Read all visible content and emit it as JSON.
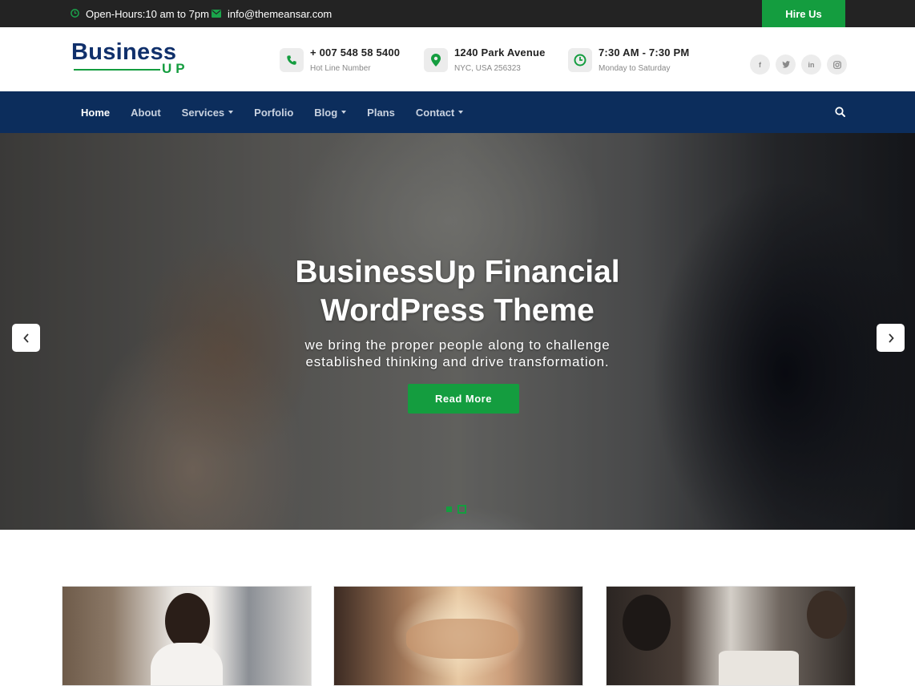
{
  "topbar": {
    "hours": "Open-Hours:10 am to 7pm",
    "email": "info@themeansar.com",
    "hire_label": "Hire Us"
  },
  "logo": {
    "main": "Business",
    "sub": "UP"
  },
  "contacts": [
    {
      "title": "+ 007 548 58 5400",
      "sub": "Hot Line Number",
      "icon": "phone-icon"
    },
    {
      "title": "1240 Park Avenue",
      "sub": "NYC, USA 256323",
      "icon": "map-pin-icon"
    },
    {
      "title": "7:30 AM - 7:30 PM",
      "sub": "Monday to Saturday",
      "icon": "clock-icon"
    }
  ],
  "socials": [
    "f",
    "t",
    "in",
    "ig"
  ],
  "nav": {
    "items": [
      {
        "label": "Home",
        "dropdown": false
      },
      {
        "label": "About",
        "dropdown": false
      },
      {
        "label": "Services",
        "dropdown": true
      },
      {
        "label": "Porfolio",
        "dropdown": false
      },
      {
        "label": "Blog",
        "dropdown": true
      },
      {
        "label": "Plans",
        "dropdown": false
      },
      {
        "label": "Contact",
        "dropdown": true
      }
    ]
  },
  "hero": {
    "title_line1": "BusinessUp Financial",
    "title_line2": "WordPress Theme",
    "sub_line1": "we bring the proper people along to challenge",
    "sub_line2": "established thinking and drive transformation.",
    "button_label": "Read More",
    "slides_total": 2,
    "active_slide": 2
  },
  "colors": {
    "accent": "#149d3f",
    "nav_bg": "#0c2d5c",
    "topbar_bg": "#232323",
    "logo": "#10306b"
  }
}
